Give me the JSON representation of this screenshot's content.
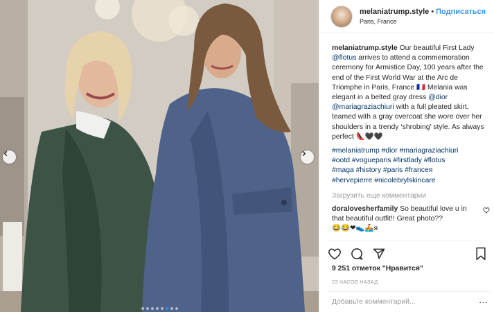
{
  "header": {
    "username": "melaniatrump.style",
    "separator": "•",
    "follow_label": "Подписаться",
    "location": "Paris, France"
  },
  "caption": {
    "username": "melaniatrump.style",
    "text_1": "Our beautiful First Lady",
    "mention_flotus": "@flotus",
    "text_2": "arrives to attend a commemoration ceremony for Armistice Day, 100 years after the end of the First World War at the Arc de Triomphe in Paris, France 🇫🇷 Melania was elegant in a belted gray dress",
    "mention_dior": "@dior",
    "mention_mgc": "@mariagraziachiuri",
    "text_3": "with a full pleated skirt, teamed with a gray overcoat she wore over her shoulders in a trendy ‘shrobing’ style. As always perfect 👠🖤🖤",
    "hashtags_1": "#melaniatrump #dior #mariagrazi­achiuri",
    "hashtags_2": "#ootd #vogueparis #firstlady #flotus",
    "hashtags_3": "#maga #history #paris #franceя",
    "hashtags_4": "#hervepierre #nicolebrylskincare"
  },
  "load_more_label": "Загрузить еще комментарии",
  "comment": {
    "username": "doralovesherfamily",
    "text": "So beautiful love u in that beautiful outfit!! Great photo??",
    "emojis": "😂😂❤👟🚣я"
  },
  "likes_text": "9 251 отметок \"Нравится\"",
  "time_text": "23 ЧАСОВ НАЗАД",
  "add_comment_placeholder": "Добавьте комментарий...",
  "more_label": "···",
  "icons": {
    "like": "heart-icon",
    "comment": "comment-icon",
    "share": "share-icon",
    "save": "bookmark-icon",
    "prev": "chevron-left-icon",
    "next": "chevron-right-icon"
  },
  "colors": {
    "accent": "#3897f0",
    "link": "#003569",
    "muted": "#999999",
    "active_dot": "#1e90ff"
  },
  "carousel": {
    "count": 8,
    "active_index": 5
  }
}
